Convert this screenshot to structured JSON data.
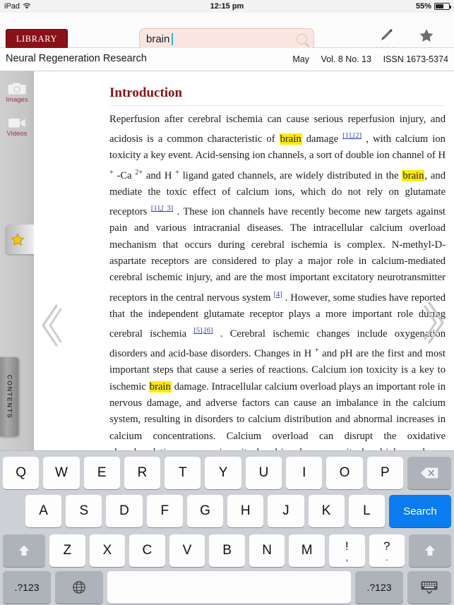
{
  "status_bar": {
    "device": "iPad",
    "wifi_icon": "wifi-icon",
    "time": "12:15 pm",
    "battery_percent": "55%",
    "battery_icon": "battery-icon"
  },
  "toolbar": {
    "library_label": "LIBRARY",
    "search": {
      "value": "brain",
      "placeholder": "",
      "icon": "search-icon"
    },
    "highlights_label": "Highlights",
    "highlights_icon": "pencil-icon",
    "favorites_label": "Favorites",
    "favorites_icon": "star-icon"
  },
  "journal_header": {
    "title": "Neural Regeneration Research",
    "month": "May",
    "volume": "Vol. 8 No. 13",
    "issn": "ISSN 1673-5374"
  },
  "sidebar": {
    "items": [
      {
        "label": "Images",
        "icon": "camera-icon"
      },
      {
        "label": "Videos",
        "icon": "video-camera-icon"
      }
    ],
    "favorites_tab_icon": "star-icon",
    "contents_tab_label": "CONTENTS",
    "knob_icon": "dial-knob-icon"
  },
  "navigation": {
    "prev_icon": "chevron-left-icon",
    "next_icon": "chevron-right-icon"
  },
  "article": {
    "section_title": "Introduction",
    "highlight_term": "brain",
    "paragraph_parts": [
      {
        "t": "Reperfusion after cerebral ischemia can cause serious reperfusion injury, and acidosis is a common characteristic of "
      },
      {
        "t": "brain",
        "hl": true
      },
      {
        "t": " damage "
      },
      {
        "t": "[1],[2]",
        "ref": true
      },
      {
        "t": " , with calcium ion toxicity a key event. Acid-sensing ion channels, a sort of double ion channel of H "
      },
      {
        "t": "+",
        "sup": true
      },
      {
        "t": " -Ca "
      },
      {
        "t": "2+",
        "sup": true
      },
      {
        "t": " and H "
      },
      {
        "t": "+",
        "sup": true
      },
      {
        "t": " ligand gated channels, are widely distributed in the "
      },
      {
        "t": "brain",
        "hl": true
      },
      {
        "t": ", and mediate the toxic effect of calcium ions, which do not rely on glutamate receptors "
      },
      {
        "t": "[1],[ 3]",
        "ref": true
      },
      {
        "t": " . These ion channels have recently become new targets against pain and various intracranial diseases. The intracellular calcium overload mechanism that occurs during cerebral ischemia is complex. N-methyl-D-aspartate receptors are considered to play a major role in calcium-mediated cerebral ischemic injury, and are the most important excitatory neurotransmitter receptors in the central nervous system "
      },
      {
        "t": "[4]",
        "ref": true
      },
      {
        "t": " . However, some studies have reported that the independent glutamate receptor plays a more important role during cerebral ischemia "
      },
      {
        "t": "[5],[6]",
        "ref": true
      },
      {
        "t": " . Cerebral ischemic changes include oxygenation disorders and acid-base disorders. Changes in H "
      },
      {
        "t": "+",
        "sup": true
      },
      {
        "t": " and pH are the first and most important steps that cause a series of reactions. Calcium ion toxicity is a key to ischemic "
      },
      {
        "t": "brain",
        "hl": true
      },
      {
        "t": " damage. Intracellular calcium overload plays an important role in nervous damage, and adverse factors can cause an imbalance in the calcium system, resulting in disorders to calcium distribution and abnormal increases in calcium concentrations. Calcium overload can disrupt the oxidative phosphorylation process in mitochondria, decrease mitochondrial membrane potential, reduce adenosine triphosphate content in tissue, and activate phospholipases and proteinases. These changes can induce and promote the irreversible damage of cells. The above-mentioned results"
      }
    ]
  },
  "keyboard": {
    "row1": [
      "Q",
      "W",
      "E",
      "R",
      "T",
      "Y",
      "U",
      "I",
      "O",
      "P"
    ],
    "delete_icon": "backspace-icon",
    "row2": [
      "A",
      "S",
      "D",
      "F",
      "G",
      "H",
      "J",
      "K",
      "L"
    ],
    "search_key_label": "Search",
    "row3": [
      "Z",
      "X",
      "C",
      "V",
      "B",
      "N",
      "M"
    ],
    "row3_extra": [
      {
        "top": "!",
        "bot": ","
      },
      {
        "top": "?",
        "bot": "."
      }
    ],
    "shift_icon": "shift-arrow-icon",
    "numeric_label": ".?123",
    "globe_icon": "globe-icon",
    "space_label": "",
    "hide_keyboard_icon": "hide-keyboard-icon"
  },
  "colors": {
    "brand_red": "#8a1119",
    "highlight_yellow": "#ffea00",
    "link_blue": "#2b3ea8",
    "search_key_blue": "#0a7cf0",
    "search_field_bg": "#fae6e0"
  }
}
